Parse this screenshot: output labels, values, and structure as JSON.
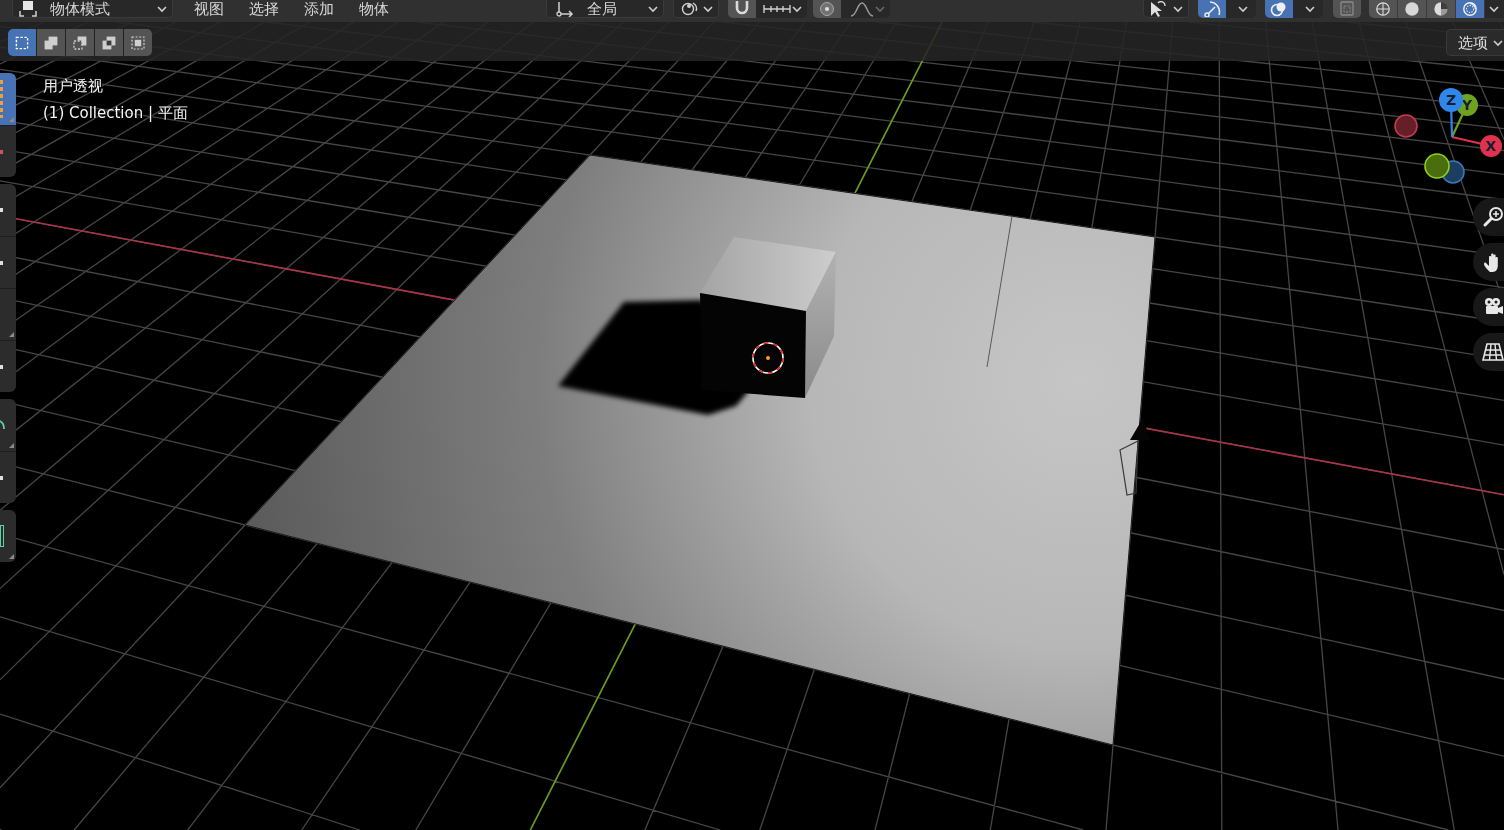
{
  "header": {
    "mode_menu": {
      "label": "物体模式"
    },
    "menus": [
      "视图",
      "选择",
      "添加",
      "物体"
    ],
    "orientation_menu": {
      "label": "全局"
    },
    "snapping": {
      "on": false
    },
    "proportional_editing": {
      "on": false
    },
    "gizmos": {
      "on": true
    },
    "overlays": {
      "on": true
    },
    "xray": {
      "on": false
    },
    "shading_modes": [
      {
        "kind": "wireframe",
        "selected": false
      },
      {
        "kind": "solid",
        "selected": false
      },
      {
        "kind": "material",
        "selected": false
      },
      {
        "kind": "rendered",
        "selected": true
      }
    ]
  },
  "tool_header": {
    "select_modes": [
      {
        "kind": "set",
        "selected": true
      },
      {
        "kind": "extend",
        "selected": false
      },
      {
        "kind": "subtract",
        "selected": false
      },
      {
        "kind": "difference",
        "selected": false
      },
      {
        "kind": "intersect",
        "selected": false
      }
    ],
    "options_menu": {
      "label": "选项"
    }
  },
  "toolbar": {
    "groups": [
      {
        "tools": [
          {
            "kind": "select",
            "selected": true,
            "flyout": true
          },
          {
            "kind": "cursor",
            "selected": false,
            "flyout": false
          }
        ]
      },
      {
        "tools": [
          {
            "kind": "move",
            "selected": false,
            "flyout": false
          },
          {
            "kind": "rotate",
            "selected": false,
            "flyout": false
          },
          {
            "kind": "scale",
            "selected": false,
            "flyout": true
          },
          {
            "kind": "transform",
            "selected": false,
            "flyout": false
          }
        ]
      },
      {
        "tools": [
          {
            "kind": "annotate",
            "selected": false,
            "flyout": true
          },
          {
            "kind": "measure",
            "selected": false,
            "flyout": false
          }
        ]
      },
      {
        "tools": [
          {
            "kind": "add",
            "selected": false,
            "flyout": true
          }
        ]
      }
    ]
  },
  "viewport": {
    "view_name": "用户透视",
    "context": "(1) Collection | 平面"
  },
  "navigation_gizmo": {
    "axes": [
      {
        "label": "Z",
        "color": "#2f86eb"
      },
      {
        "label": "Y",
        "color": "#6ea31f"
      },
      {
        "label": "X",
        "color": "#e0314f"
      }
    ],
    "negative_axes": [
      {
        "color": "#c23b4e"
      },
      {
        "color": "#8fd11b"
      },
      {
        "color": "#3a77b8"
      }
    ]
  }
}
